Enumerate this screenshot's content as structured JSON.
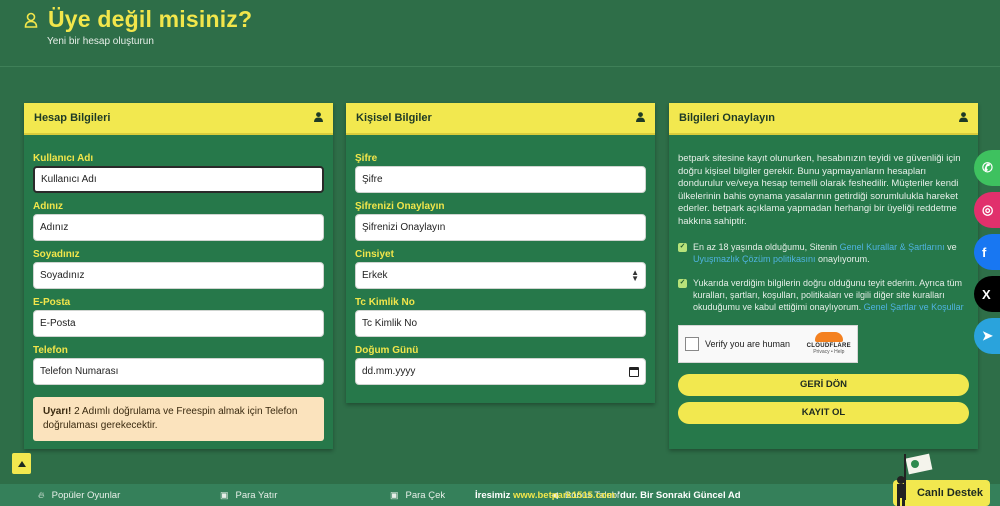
{
  "header": {
    "title": "Üye değil misiniz?",
    "subtitle": "Yeni bir hesap oluşturun",
    "title_color": "#f2e64b"
  },
  "account_panel": {
    "title": "Hesap Bilgileri",
    "fields": [
      {
        "label": "Kullanıcı Adı",
        "placeholder": "Kullanıcı Adı"
      },
      {
        "label": "Adınız",
        "placeholder": "Adınız"
      },
      {
        "label": "Soyadınız",
        "placeholder": "Soyadınız"
      },
      {
        "label": "E-Posta",
        "placeholder": "E-Posta"
      },
      {
        "label": "Telefon",
        "placeholder": "Telefon Numarası"
      }
    ],
    "warning_bold": "Uyarı!",
    "warning_text": " 2 Adımlı doğrulama ve Freespin almak için Telefon doğrulaması gerekecektir."
  },
  "personal_panel": {
    "title": "Kişisel Bilgiler",
    "fields": [
      {
        "label": "Şifre",
        "placeholder": "Şifre"
      },
      {
        "label": "Şifrenizi Onaylayın",
        "placeholder": "Şifrenizi Onaylayın"
      },
      {
        "label": "Cinsiyet",
        "value": "Erkek"
      },
      {
        "label": "Tc Kimlik No",
        "placeholder": "Tc Kimlik No"
      },
      {
        "label": "Doğum Günü",
        "placeholder": "dd.mm.yyyy"
      }
    ]
  },
  "confirm_panel": {
    "title": "Bilgileri Onaylayın",
    "paragraph": "betpark sitesine kayıt olunurken, hesabınızın teyidi ve güvenliği için doğru kişisel bilgiler gerekir. Bunu yapmayanların hesapları dondurulur ve/veya hesap temelli olarak feshedilir. Müşteriler kendi ülkelerinin bahis oynama yasalarının getirdiği sorumlulukla hareket ederler. betpark açıklama yapmadan herhangi bir üyeliği reddetme hakkına sahiptir.",
    "check1_pre": "En az 18 yaşında olduğumu, Sitenin ",
    "check1_link1": "Genel Kurallar & Şartlarını",
    "check1_mid": " ve ",
    "check1_link2": "Uyuşmazlık Çözüm politikasını",
    "check1_post": " onaylıyorum.",
    "check2_pre": "Yukarıda verdiğim bilgilerin doğru olduğunu teyit ederim. Ayrıca tüm kuralları, şartları, koşulları, politikaları ve ilgili diğer site kuralları okuduğumu ve kabul ettiğimi onaylıyorum. ",
    "check2_link": "Genel Şartlar ve Koşullar",
    "captcha_label": "Verify you are human",
    "captcha_brand": "CLOUDFLARE",
    "captcha_links": "Privacy • Help",
    "back_button": "GERİ DÖN",
    "register_button": "KAYIT OL"
  },
  "social": [
    {
      "name": "whatsapp-icon",
      "glyph": "✆",
      "color": "#3ec15f"
    },
    {
      "name": "instagram-icon",
      "glyph": "◎",
      "color": "#e1306c"
    },
    {
      "name": "facebook-icon",
      "glyph": "f",
      "color": "#1877f2"
    },
    {
      "name": "x-icon",
      "glyph": "X",
      "color": "#000000"
    },
    {
      "name": "telegram-icon",
      "glyph": "➤",
      "color": "#2aa3dc"
    }
  ],
  "bottom_nav": {
    "popular": "Popüler Oyunlar",
    "deposit": "Para Yatır",
    "withdraw": "Para Çek",
    "bonus": "Bonus Talebi",
    "ticker_pre": "İresimiz ",
    "ticker_url": "www.betpark1515.com",
    "ticker_post": " 'dur. Bir Sonraki Güncel Ad",
    "live_support": "Canlı Destek"
  }
}
